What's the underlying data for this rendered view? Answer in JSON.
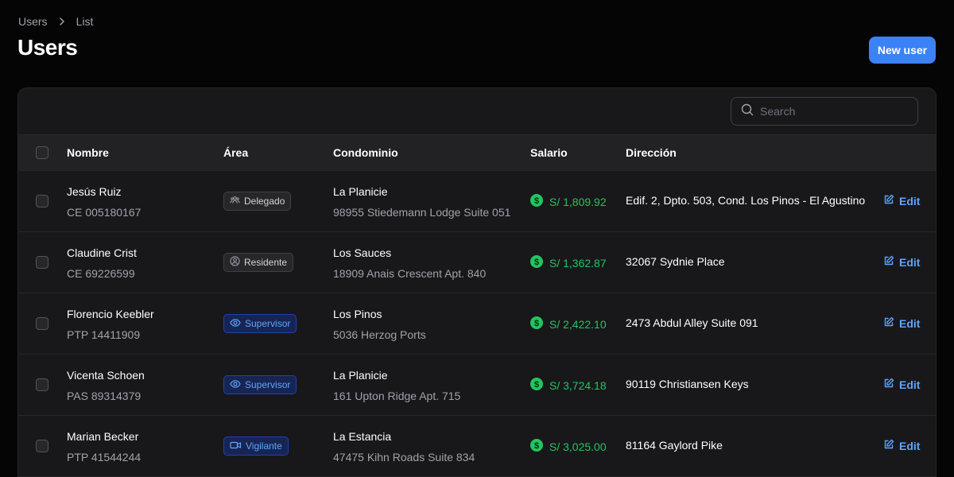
{
  "breadcrumb": {
    "items": [
      "Users",
      "List"
    ]
  },
  "page": {
    "title": "Users",
    "new_user_label": "New user"
  },
  "search": {
    "placeholder": "Search"
  },
  "table": {
    "headers": {
      "nombre": "Nombre",
      "area": "Área",
      "condominio": "Condominio",
      "salario": "Salario",
      "direccion": "Dirección"
    },
    "edit_label": "Edit",
    "rows": [
      {
        "name": "Jesús Ruiz",
        "doc": "CE 005180167",
        "area": "Delegado",
        "area_icon": "group-icon",
        "condo": "La Planicie",
        "condo_addr": "98955 Stiedemann Lodge Suite 051",
        "salary": "S/ 1,809.92",
        "address": "Edif. 2, Dpto. 503, Cond. Los Pinos - El Agustino"
      },
      {
        "name": "Claudine Crist",
        "doc": "CE 69226599",
        "area": "Residente",
        "area_icon": "user-circle-icon",
        "condo": "Los Sauces",
        "condo_addr": "18909 Anais Crescent Apt. 840",
        "salary": "S/ 1,362.87",
        "address": "32067 Sydnie Place"
      },
      {
        "name": "Florencio Keebler",
        "doc": "PTP 14411909",
        "area": "Supervisor",
        "area_icon": "eye-icon",
        "condo": "Los Pinos",
        "condo_addr": "5036 Herzog Ports",
        "salary": "S/ 2,422.10",
        "address": "2473 Abdul Alley Suite 091"
      },
      {
        "name": "Vicenta Schoen",
        "doc": "PAS 89314379",
        "area": "Supervisor",
        "area_icon": "eye-icon",
        "condo": "La Planicie",
        "condo_addr": "161 Upton Ridge Apt. 715",
        "salary": "S/ 3,724.18",
        "address": "90119 Christiansen Keys"
      },
      {
        "name": "Marian Becker",
        "doc": "PTP 41544244",
        "area": "Vigilante",
        "area_icon": "video-camera-icon",
        "condo": "La Estancia",
        "condo_addr": "47475 Kihn Roads Suite 834",
        "salary": "S/ 3,025.00",
        "address": "81164 Gaylord Pike"
      }
    ]
  },
  "colors": {
    "accent": "#3b82f6",
    "salary_green": "#22c55e",
    "badge_blue_text": "#60a5fa",
    "background": "#050505",
    "card": "#18181b"
  }
}
